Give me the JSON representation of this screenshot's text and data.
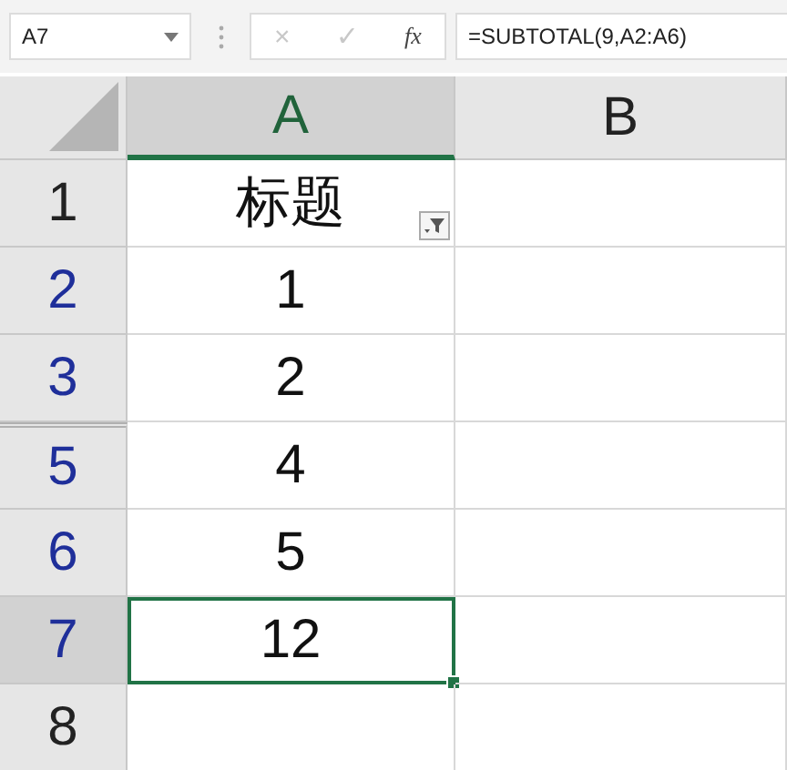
{
  "name_box": {
    "value": "A7"
  },
  "formula_bar": {
    "cancel": "×",
    "enter": "✓",
    "function": "fx",
    "formula": "=SUBTOTAL(9,A2:A6)"
  },
  "columns": [
    {
      "label": "A",
      "selected": true
    },
    {
      "label": "B",
      "selected": false
    }
  ],
  "rows": [
    {
      "header": "1",
      "filtered": false,
      "selected": false,
      "hidden_before": false,
      "cells": [
        {
          "value": "标题",
          "filter_button": true,
          "selected": false
        },
        {
          "selected": false
        }
      ]
    },
    {
      "header": "2",
      "filtered": true,
      "selected": false,
      "hidden_before": false,
      "cells": [
        {
          "value": "1",
          "selected": false
        },
        {
          "selected": false
        }
      ]
    },
    {
      "header": "3",
      "filtered": true,
      "selected": false,
      "hidden_before": false,
      "cells": [
        {
          "value": "2",
          "selected": false
        },
        {
          "selected": false
        }
      ]
    },
    {
      "header": "5",
      "filtered": true,
      "selected": false,
      "hidden_before": true,
      "cells": [
        {
          "value": "4",
          "selected": false
        },
        {
          "selected": false
        }
      ]
    },
    {
      "header": "6",
      "filtered": true,
      "selected": false,
      "hidden_before": false,
      "cells": [
        {
          "value": "5",
          "selected": false
        },
        {
          "selected": false
        }
      ]
    },
    {
      "header": "7",
      "filtered": true,
      "selected": true,
      "hidden_before": false,
      "cells": [
        {
          "value": "12",
          "selected": true
        },
        {
          "selected": false
        }
      ]
    },
    {
      "header": "8",
      "filtered": false,
      "selected": false,
      "hidden_before": false,
      "cells": [
        {
          "selected": false
        },
        {
          "selected": false
        }
      ]
    }
  ]
}
